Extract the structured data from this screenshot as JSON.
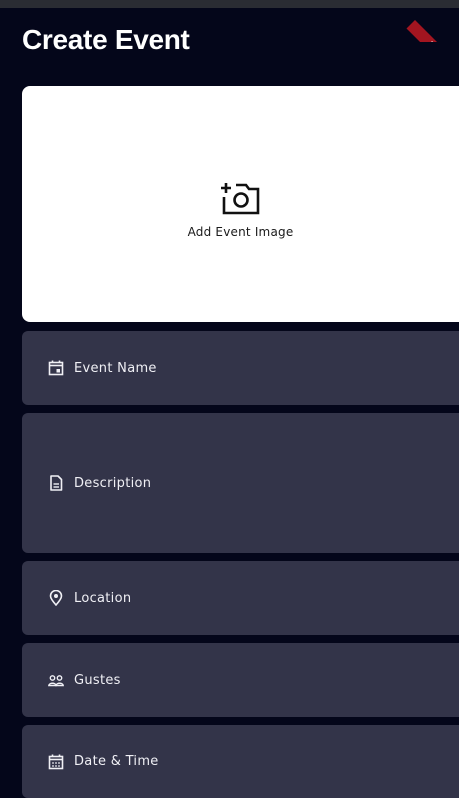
{
  "appbar": {
    "title": "Create Event",
    "debug_banner": "DEBUG"
  },
  "image_picker": {
    "label": "Add Event Image"
  },
  "fields": {
    "event_name": "Event Name",
    "description": "Description",
    "location": "Location",
    "guests": "Gustes",
    "date_time": "Date & Time"
  },
  "colors": {
    "background": "#04061a",
    "field_background": "#333449",
    "card_background": "#ffffff",
    "text": "#f0f0f5"
  }
}
